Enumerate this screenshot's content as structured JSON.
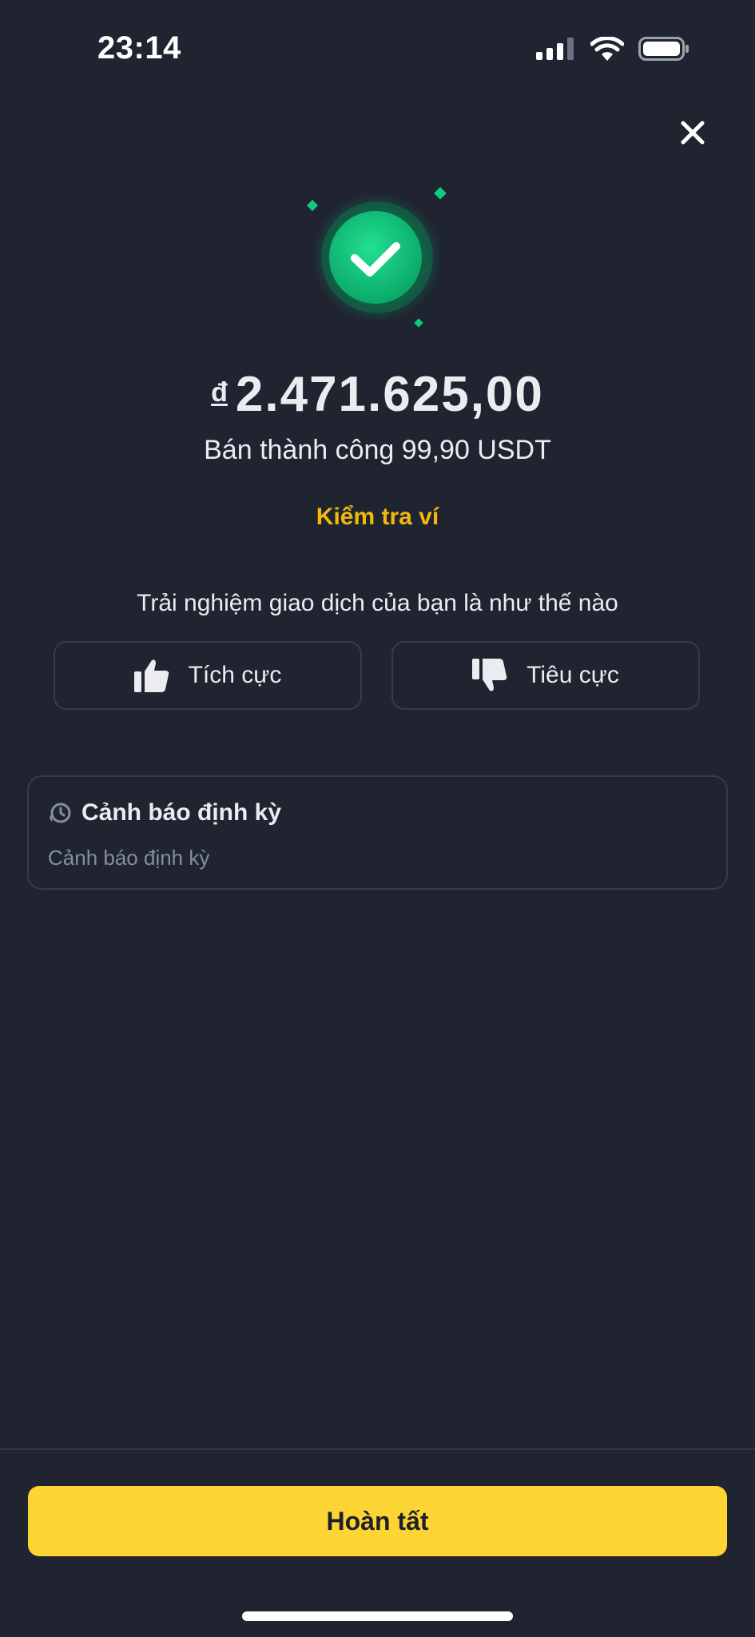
{
  "status_bar": {
    "time": "23:14",
    "icons": [
      "signal-icon",
      "wifi-icon",
      "battery-icon"
    ]
  },
  "header": {
    "close_icon": "close-icon"
  },
  "result": {
    "currency_symbol": "đ",
    "amount": "2.471.625,00",
    "subtitle": "Bán thành công 99,90 USDT",
    "check_wallet_label": "Kiểm tra ví",
    "success_icon": "check-circle-icon"
  },
  "feedback": {
    "question": "Trải nghiệm giao dịch của bạn là như thế nào",
    "positive_label": "Tích cực",
    "negative_label": "Tiêu cực"
  },
  "alert": {
    "title": "Cảnh báo định kỳ",
    "description": "Cảnh báo định kỳ",
    "icon": "alarm-icon"
  },
  "footer": {
    "done_label": "Hoàn tất"
  },
  "colors": {
    "background": "#1f2430",
    "accent_yellow": "#fcd535",
    "link_yellow": "#f0b90b",
    "success_green": "#0ecb81",
    "text_primary": "#eaecef",
    "text_secondary": "#848e9c",
    "border": "#363c49"
  }
}
